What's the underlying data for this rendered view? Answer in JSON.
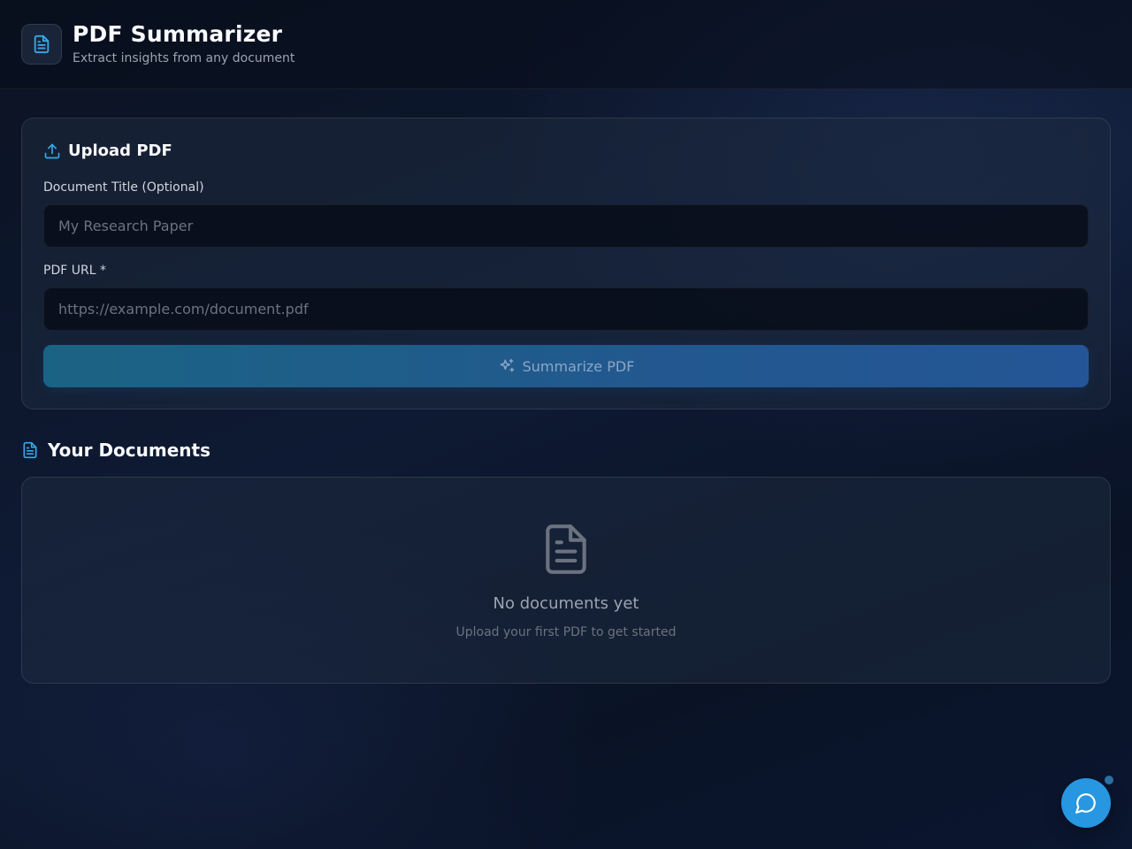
{
  "header": {
    "title": "PDF Summarizer",
    "subtitle": "Extract insights from any document",
    "logo_icon": "file-text-icon"
  },
  "upload": {
    "heading": "Upload PDF",
    "heading_icon": "upload-icon",
    "title_label": "Document Title (Optional)",
    "title_placeholder": "My Research Paper",
    "title_value": "",
    "url_label": "PDF URL *",
    "url_placeholder": "https://example.com/document.pdf",
    "url_value": "",
    "submit_label": "Summarize PDF",
    "submit_icon": "sparkles-icon"
  },
  "documents": {
    "heading": "Your Documents",
    "heading_icon": "file-text-icon",
    "empty_icon": "file-text-icon",
    "empty_title": "No documents yet",
    "empty_subtitle": "Upload your first PDF to get started"
  },
  "chat": {
    "icon": "chat-bubble-icon"
  },
  "colors": {
    "accent": "#2697e0",
    "icon_accent": "#38a7e8"
  }
}
